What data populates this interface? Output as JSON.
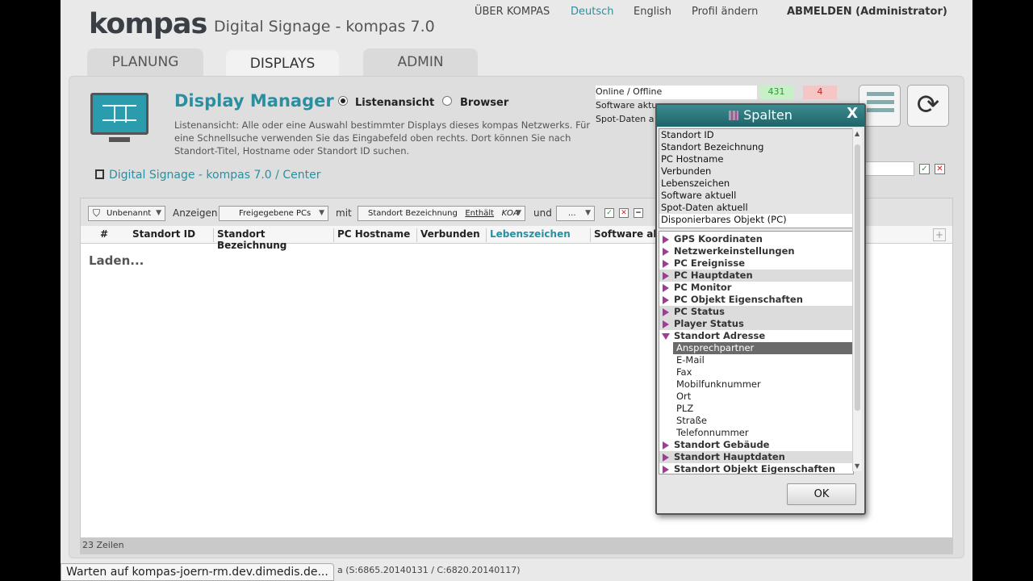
{
  "header": {
    "logo_text": "kompas",
    "app_title": "Digital Signage - kompas 7.0",
    "nav": {
      "about": "ÜBER KOMPAS",
      "deutsch": "Deutsch",
      "english": "English",
      "profile": "Profil ändern",
      "logout": "ABMELDEN (Administrator)"
    },
    "tabs": [
      "PLANUNG",
      "DISPLAYS",
      "ADMIN"
    ]
  },
  "display_manager": {
    "title": "Display Manager",
    "view_list": "Listenansicht",
    "view_browser": "Browser",
    "description": "Listenansicht: Alle oder eine Auswahl bestimmter Displays dieses kompas Netzwerks. Für eine Schnellsuche verwenden Sie das Eingabefeld oben rechts. Dort können Sie nach Standort-Titel, Hostname oder Standort ID suchen.",
    "breadcrumb": "Digital Signage - kompas 7.0 / Center"
  },
  "stats": {
    "online_label": "Online / Offline",
    "online": "431",
    "offline": "4",
    "software_label": "Software aktu",
    "spot_label": "Spot-Daten a"
  },
  "filter": {
    "unnamed": "Unbenannt",
    "show_label": "Anzeigen",
    "released_pcs": "Freigegebene PCs",
    "with_label": "mit",
    "condition_field": "Standort Bezeichnung",
    "condition_op": "Enthält",
    "condition_value": "KOA",
    "and_label": "und",
    "and_value": "..."
  },
  "columns": [
    "#",
    "Standort ID",
    "Standort Bezeichnung",
    "PC Hostname",
    "Verbunden",
    "Lebenszeichen",
    "Software ak"
  ],
  "list": {
    "loading": "Laden...",
    "rows": "23 Zeilen"
  },
  "version_text": "a (S:6865.20140131 / C:6820.20140117)",
  "browser_status": "Warten auf kompas-joern-rm.dev.dimedis.de...",
  "dialog": {
    "title": "Spalten",
    "close": "X",
    "selected": [
      "Standort ID",
      "Standort Bezeichnung",
      "PC Hostname",
      "Verbunden",
      "Lebenszeichen",
      "Software aktuell",
      "Spot-Daten aktuell",
      "Disponierbares Objekt (PC)"
    ],
    "groups_before": [
      "GPS Koordinaten",
      "Netzwerkeinstellungen",
      "PC Ereignisse",
      "PC Hauptdaten",
      "PC Monitor",
      "PC Objekt Eigenschaften",
      "PC Status",
      "Player Status"
    ],
    "expanded_group": "Standort Adresse",
    "expanded_children": [
      "Ansprechpartner",
      "E-Mail",
      "Fax",
      "Mobilfunknummer",
      "Ort",
      "PLZ",
      "Straße",
      "Telefonnummer"
    ],
    "groups_after": [
      "Standort Gebäude",
      "Standort Hauptdaten",
      "Standort Objekt Eigenschaften"
    ],
    "ok": "OK"
  },
  "colors": {
    "accent": "#2a8fa0",
    "online_bg": "#c8f0c8",
    "offline_bg": "#f5c6c6",
    "tree_marker": "#a03c96"
  }
}
